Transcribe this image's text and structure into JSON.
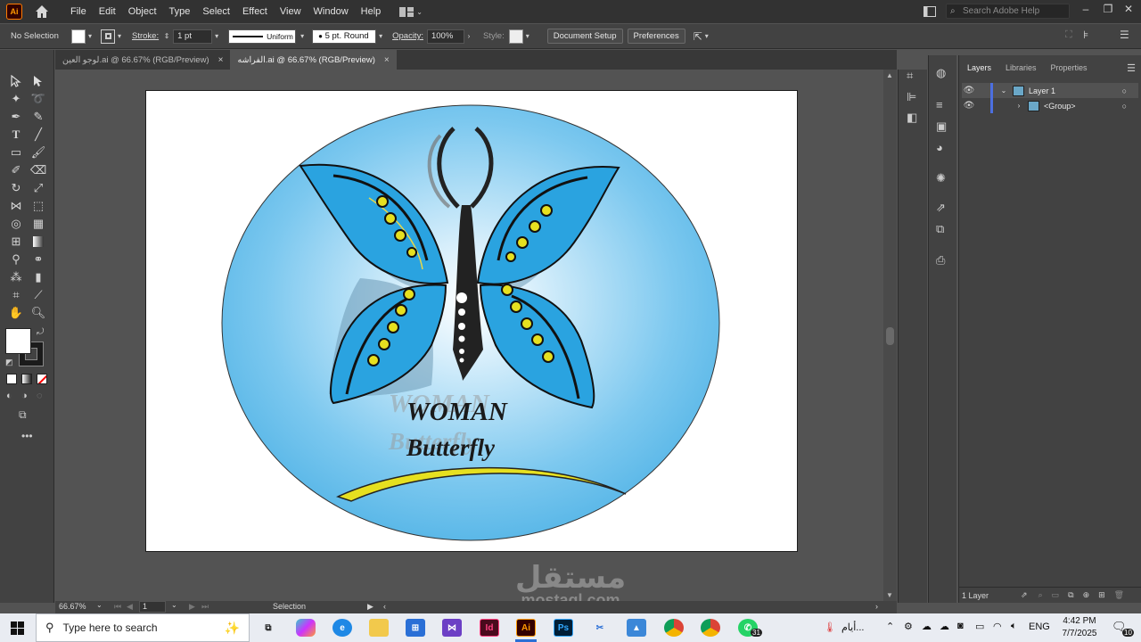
{
  "app": {
    "logo_text": "Ai",
    "brand_color": "#ff9a00"
  },
  "menu": {
    "items": [
      "File",
      "Edit",
      "Object",
      "Type",
      "Select",
      "Effect",
      "View",
      "Window",
      "Help"
    ]
  },
  "search": {
    "placeholder": "Search Adobe Help"
  },
  "control_bar": {
    "selection": "No Selection",
    "stroke_label": "Stroke:",
    "stroke_weight": "1 pt",
    "stroke_profile": "Uniform",
    "brush": "5 pt. Round",
    "opacity_label": "Opacity:",
    "opacity_value": "100%",
    "style_label": "Style:",
    "document_setup": "Document Setup",
    "preferences": "Preferences"
  },
  "tabs": [
    {
      "label": "لوجو العين.ai @ 66.67% (RGB/Preview)",
      "active": false
    },
    {
      "label": "الفراشه.ai @ 66.67% (RGB/Preview)",
      "active": true
    }
  ],
  "artwork": {
    "title_line1": "WOMAN",
    "title_line2": "Butterfly",
    "bg_color": "#5bb8e8",
    "wing_color": "#2aa3e0"
  },
  "layers_panel": {
    "tabs": [
      "Layers",
      "Libraries",
      "Properties"
    ],
    "rows": [
      {
        "name": "Layer 1",
        "expanded": true
      },
      {
        "name": "<Group>",
        "expanded": false
      }
    ],
    "footer_count": "1 Layer"
  },
  "status_bar": {
    "zoom": "66.67%",
    "artboard": "1",
    "tool": "Selection"
  },
  "watermark": {
    "arabic": "مستقل",
    "latin": "mostaql.com"
  },
  "taskbar": {
    "search_placeholder": "Type here to search",
    "weather": "أيام...",
    "language": "ENG",
    "time": "4:42 PM",
    "date": "7/7/2025",
    "whatsapp_badge": "31",
    "notification_badge": "10"
  }
}
